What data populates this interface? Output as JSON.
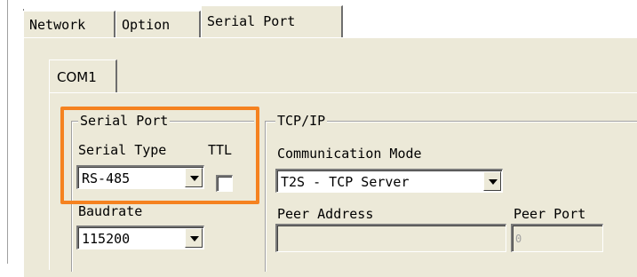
{
  "tabs": [
    {
      "label": "Network",
      "active": false
    },
    {
      "label": "Option",
      "active": false
    },
    {
      "label": "Serial Port",
      "active": true
    }
  ],
  "com_tabs": [
    {
      "label": "COM1",
      "active": true
    }
  ],
  "serial_port_group": {
    "title": "Serial Port",
    "serial_type_label": "Serial Type",
    "serial_type_value": "RS-485",
    "ttl_label": "TTL",
    "ttl_checked": false,
    "baudrate_label": "Baudrate",
    "baudrate_value": "115200"
  },
  "tcpip_group": {
    "title": "TCP/IP",
    "comm_mode_label": "Communication Mode",
    "comm_mode_value": "T2S - TCP Server",
    "peer_address_label": "Peer Address",
    "peer_address_value": "",
    "peer_port_label": "Peer Port",
    "peer_port_value": "0"
  },
  "colors": {
    "highlight": "#f58220",
    "panel_background": "#ece9d8"
  },
  "icons": {
    "dropdown": "chevron-down-icon"
  }
}
